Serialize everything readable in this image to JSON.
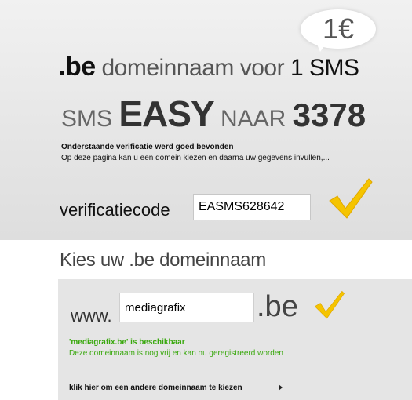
{
  "price_bubble": {
    "text": "1€"
  },
  "headline": {
    "tld": ".be",
    "middle": " domeinnaam voor ",
    "sms": "1 SMS"
  },
  "slogan": {
    "part1": "SMS ",
    "keyword": "EASY",
    "part2": " NAAR ",
    "number": "3378"
  },
  "verification": {
    "title": "Onderstaande verificatie werd goed bevonden",
    "subtitle": "Op deze pagina kan u een domein kiezen en daarna uw gegevens invullen,...",
    "label": "verificatiecode",
    "code_value": "EASMS628642"
  },
  "domain_section": {
    "title": "Kies uw .be domeinnaam",
    "prefix": "www.",
    "domain_value": "mediagrafix",
    "suffix": ".be",
    "availability_title": "'mediagrafix.be' is beschikbaar",
    "availability_text": "Deze domeinnaam is nog vrij en kan nu geregistreerd worden",
    "other_domain_link": "klik hier om een andere domeinnaam te kiezen"
  },
  "colors": {
    "accent_check": "#f5c400",
    "available_green": "#39a80d",
    "panel_bg": "#e5e5e5"
  },
  "icons": [
    "speech-bubble-icon",
    "checkmark-icon",
    "arrow-right-icon"
  ]
}
